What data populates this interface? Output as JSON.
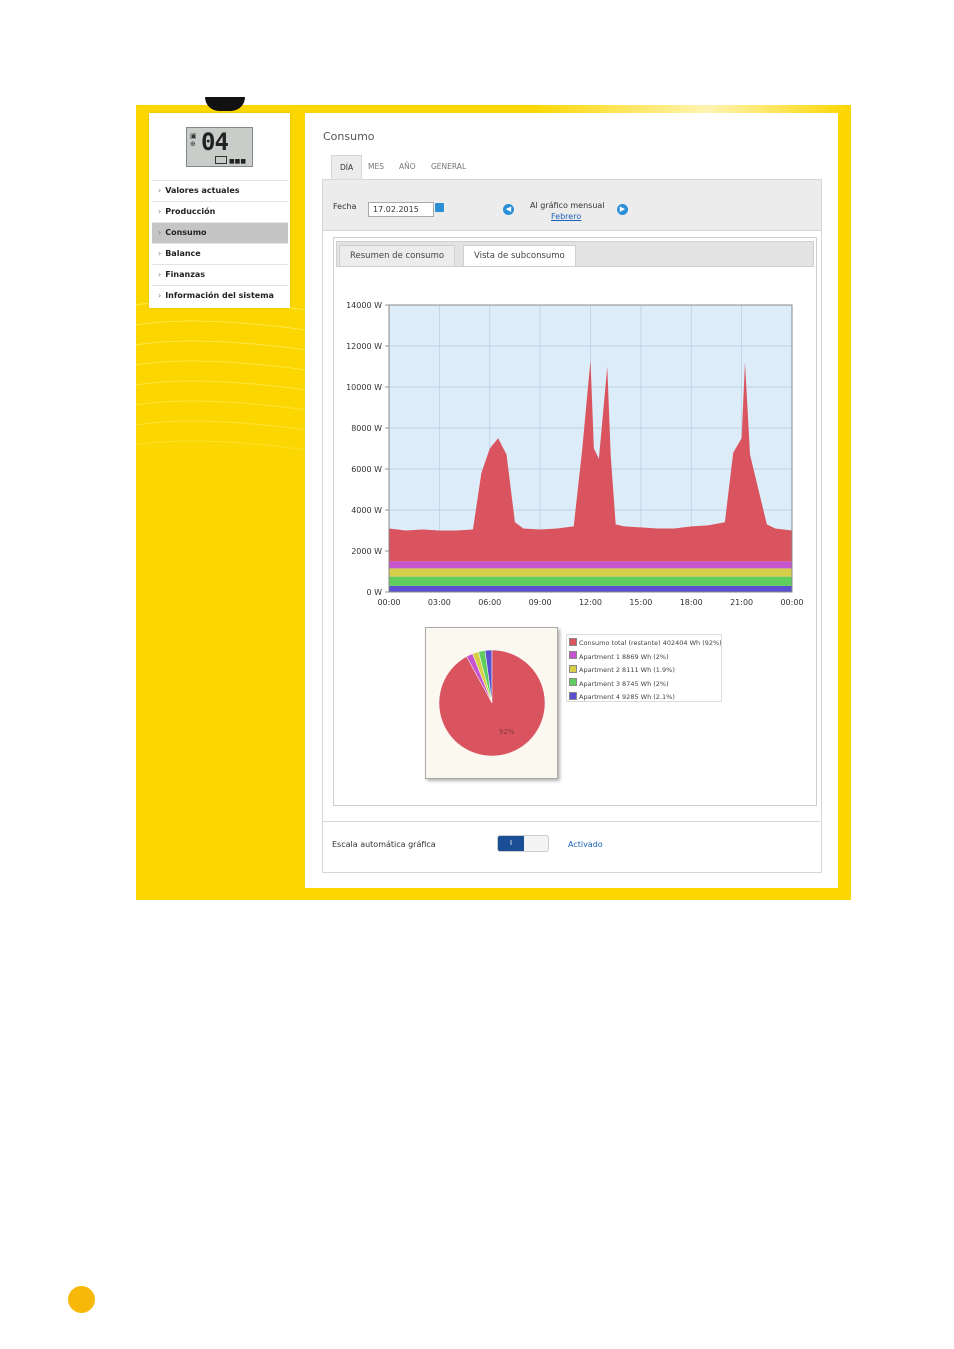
{
  "sidebar": {
    "lcd": {
      "digits": "04"
    },
    "items": [
      {
        "label": "Valores actuales",
        "active": false
      },
      {
        "label": "Producción",
        "active": false
      },
      {
        "label": "Consumo",
        "active": true
      },
      {
        "label": "Balance",
        "active": false
      },
      {
        "label": "Finanzas",
        "active": false
      },
      {
        "label": "Información del sistema",
        "active": false
      }
    ]
  },
  "main": {
    "title": "Consumo",
    "tabs": [
      {
        "label": "DÍA",
        "active": true
      },
      {
        "label": "MES",
        "active": false
      },
      {
        "label": "AÑO",
        "active": false
      },
      {
        "label": "GENERAL",
        "active": false
      }
    ],
    "date_label": "Fecha",
    "date_value": "17.02.2015",
    "monthly_label": "Al gráfico mensual",
    "monthly_link": "Febrero",
    "subtabs": [
      {
        "label": "Resumen de consumo",
        "active": false
      },
      {
        "label": "Vista de subconsumo",
        "active": true
      }
    ],
    "auto_scale_label": "Escala automática gráfica",
    "toggle_label": "I",
    "auto_scale_value": "Activado"
  },
  "colors": {
    "total": "#d9545e",
    "apt1": "#c654cf",
    "apt2": "#d7cf4a",
    "apt3": "#5fce5f",
    "apt4": "#5a4fd0",
    "plot_bg": "#dcecf8",
    "frame": "#fcd600"
  },
  "chart_data": [
    {
      "type": "area",
      "stacked": true,
      "x_ticks": [
        "00:00",
        "03:00",
        "06:00",
        "09:00",
        "12:00",
        "15:00",
        "18:00",
        "21:00",
        "00:00"
      ],
      "y_ticks": [
        "0 W",
        "2000 W",
        "4000 W",
        "6000 W",
        "8000 W",
        "10000 W",
        "12000 W",
        "14000 W"
      ],
      "ylim": [
        0,
        14000
      ],
      "grid": true,
      "x_hours": [
        0,
        1,
        2,
        3,
        4,
        5,
        5.5,
        6,
        6.5,
        7,
        7.5,
        8,
        9,
        10,
        11,
        11.5,
        12,
        12.2,
        12.5,
        13,
        13.2,
        13.5,
        14,
        15,
        16,
        17,
        18,
        19,
        20,
        20.5,
        21,
        21.2,
        21.5,
        22,
        22.5,
        23,
        24
      ],
      "series": [
        {
          "key": "apt4",
          "values": [
            300,
            300,
            300,
            300,
            300,
            300,
            300,
            300,
            300,
            300,
            300,
            300,
            300,
            300,
            300,
            300,
            300,
            300,
            300,
            300,
            300,
            300,
            300,
            300,
            300,
            300,
            300,
            300,
            300,
            300,
            300,
            300,
            300,
            300,
            300,
            300,
            300
          ]
        },
        {
          "key": "apt3",
          "values": [
            450,
            450,
            450,
            450,
            450,
            450,
            450,
            450,
            450,
            450,
            450,
            450,
            450,
            450,
            450,
            450,
            450,
            450,
            450,
            450,
            450,
            450,
            450,
            450,
            450,
            450,
            450,
            450,
            450,
            450,
            450,
            450,
            450,
            450,
            450,
            450,
            450
          ]
        },
        {
          "key": "apt2",
          "values": [
            400,
            400,
            400,
            400,
            400,
            400,
            400,
            400,
            400,
            400,
            400,
            400,
            400,
            400,
            400,
            400,
            400,
            400,
            400,
            400,
            400,
            400,
            400,
            400,
            400,
            400,
            400,
            400,
            400,
            400,
            400,
            400,
            400,
            400,
            400,
            400,
            400
          ]
        },
        {
          "key": "apt1",
          "values": [
            350,
            350,
            350,
            350,
            350,
            350,
            350,
            350,
            350,
            350,
            350,
            350,
            350,
            350,
            350,
            350,
            350,
            350,
            350,
            350,
            350,
            350,
            350,
            350,
            350,
            350,
            350,
            350,
            350,
            350,
            350,
            350,
            350,
            350,
            350,
            350,
            350
          ]
        },
        {
          "key": "total",
          "values": [
            1600,
            1500,
            1550,
            1500,
            1500,
            1550,
            4300,
            5500,
            6000,
            5200,
            1900,
            1600,
            1550,
            1600,
            1700,
            5400,
            9800,
            5500,
            5000,
            9500,
            5200,
            1800,
            1700,
            1650,
            1600,
            1600,
            1700,
            1750,
            1900,
            5300,
            6000,
            9700,
            5200,
            3500,
            1800,
            1600,
            1500
          ]
        }
      ]
    },
    {
      "type": "pie",
      "slices": [
        {
          "key": "total",
          "label": "Consumo total (restante) 402404 Wh (92%)",
          "value": 92
        },
        {
          "key": "apt1",
          "label": "Apartment 1 8869 Wh (2%)",
          "value": 2
        },
        {
          "key": "apt2",
          "label": "Apartment 2 8111 Wh (1.9%)",
          "value": 1.9
        },
        {
          "key": "apt3",
          "label": "Apartment 3 8745 Wh (2%)",
          "value": 2
        },
        {
          "key": "apt4",
          "label": "Apartment 4 9285 Wh (2.1%)",
          "value": 2.1
        }
      ],
      "center_label": "92%"
    }
  ]
}
